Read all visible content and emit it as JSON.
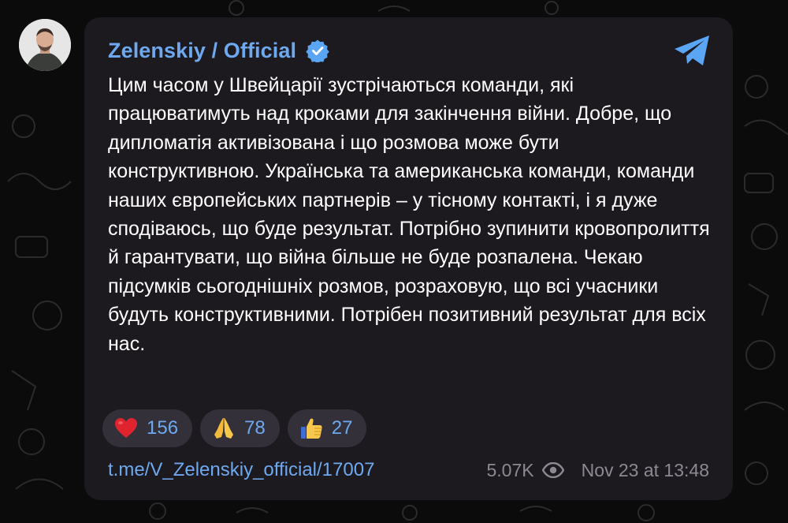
{
  "channel": {
    "name": "Zelenskiy / Official",
    "verified": true,
    "avatar_icon": "person-photo-avatar",
    "app_icon": "telegram-paper-plane-icon"
  },
  "message": {
    "text": "Цим часом у Швейцарії зустрічаються команди, які працюватимуть над кроками для закінчення війни. Добре, що дипломатія активізована і що розмова може бути конструктивною. Українська та американська команди, команди наших європейських партнерів – у тісному контакті, і я дуже сподіваюсь, що буде результат. Потрібно зупинити кровопролиття й гарантувати, що війна більше не буде розпалена. Чекаю підсумків сьогоднішніх розмов, розраховую, що всі учасники будуть конструктивними. Потрібен позитивний результат для всіх нас."
  },
  "reactions": [
    {
      "icon": "red-heart-icon",
      "count": "156"
    },
    {
      "icon": "folded-hands-icon",
      "count": "78"
    },
    {
      "icon": "thumbs-up-icon",
      "count": "27"
    }
  ],
  "footer": {
    "link": "t.me/V_Zelenskiy_official/17007",
    "views": "5.07K",
    "views_icon": "eye-icon",
    "timestamp": "Nov 23 at 13:48"
  },
  "colors": {
    "background": "#0b0b0c",
    "card": "#1d1a1f",
    "accent": "#6ea9f0",
    "text": "#ffffff",
    "muted": "#8d8892",
    "reaction_pill": "#34303a"
  }
}
